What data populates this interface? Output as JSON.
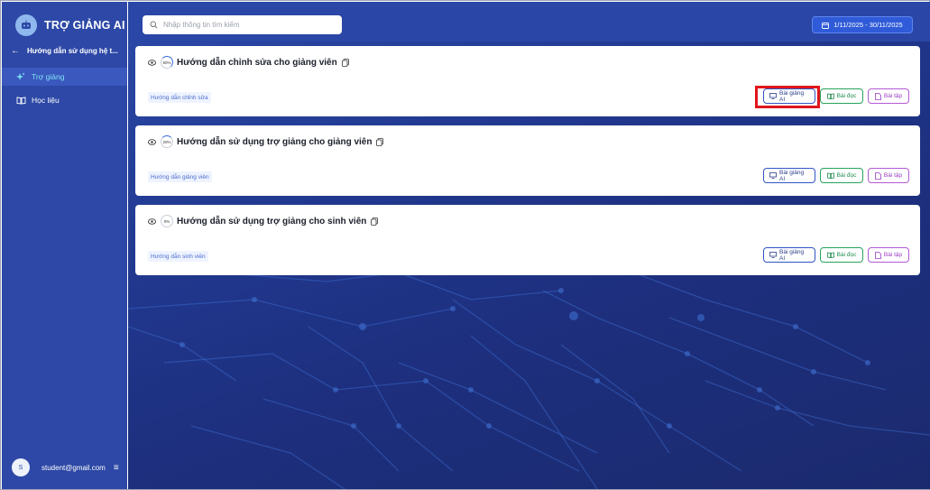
{
  "sidebar": {
    "brand": "TRỢ GIẢNG AI",
    "back_label": "Hướng dẫn sử dụng hệ t...",
    "items": [
      {
        "label": "Trợ giảng",
        "icon": "sparkle-icon",
        "active": true
      },
      {
        "label": "Học liệu",
        "icon": "book-icon",
        "active": false
      }
    ],
    "user": {
      "initial": "S",
      "email": "student@gmail.com"
    }
  },
  "header": {
    "search_placeholder": "Nhập thông tin tìm kiếm",
    "date_range": "1/11/2025 - 30/11/2025"
  },
  "cards": [
    {
      "title": "Hướng dẫn chỉnh sửa cho giảng viên",
      "progress": "50%",
      "tag": "Hướng dẫn chỉnh sửa"
    },
    {
      "title": "Hướng dẫn sử dụng trợ giảng cho giảng viên",
      "progress": "20%",
      "tag": "Hướng dẫn giảng viên"
    },
    {
      "title": "Hướng dẫn sử dụng trợ giảng cho sinh viên",
      "progress": "0%",
      "tag": "Hướng dẫn sinh viên"
    }
  ],
  "buttons": {
    "lecture_ai": "Bài giảng AI",
    "reading": "Bài đọc",
    "exercise": "Bài tập"
  },
  "colors": {
    "sidebar_bg": "#2d48a6",
    "active_text": "#7ee0f5",
    "highlight": "#e0161b"
  }
}
